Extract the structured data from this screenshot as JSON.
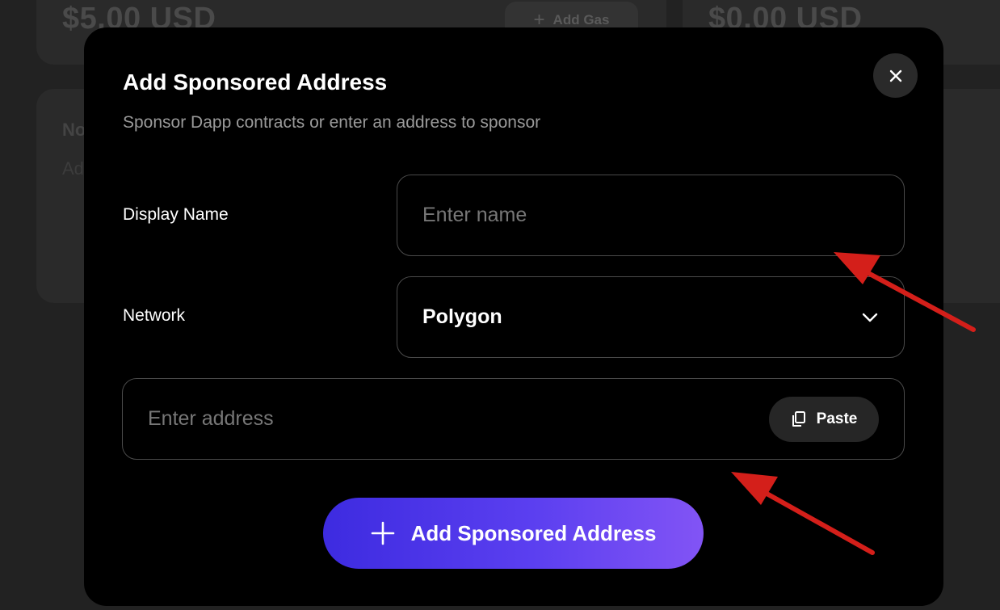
{
  "background": {
    "balance_left": "$5.00 USD",
    "balance_right": "$0.00 USD",
    "add_gas_label": "Add Gas",
    "card_fragment_1": "No",
    "card_fragment_2": "Ad"
  },
  "modal": {
    "title": "Add Sponsored Address",
    "subtitle": "Sponsor Dapp contracts or enter an address to sponsor",
    "close_label": "×",
    "display_name": {
      "label": "Display Name",
      "placeholder": "Enter name",
      "value": ""
    },
    "network": {
      "label": "Network",
      "selected": "Polygon"
    },
    "address": {
      "placeholder": "Enter address",
      "value": "",
      "paste_label": "Paste"
    },
    "submit_label": "Add Sponsored Address"
  },
  "colors": {
    "accent_start": "#3d2be0",
    "accent_end": "#8254f5",
    "annotation_arrow": "#d41f1a"
  },
  "icons": {
    "close": "close-icon",
    "chevron": "chevron-down-icon",
    "paste": "copy-icon",
    "plus": "plus-icon"
  }
}
